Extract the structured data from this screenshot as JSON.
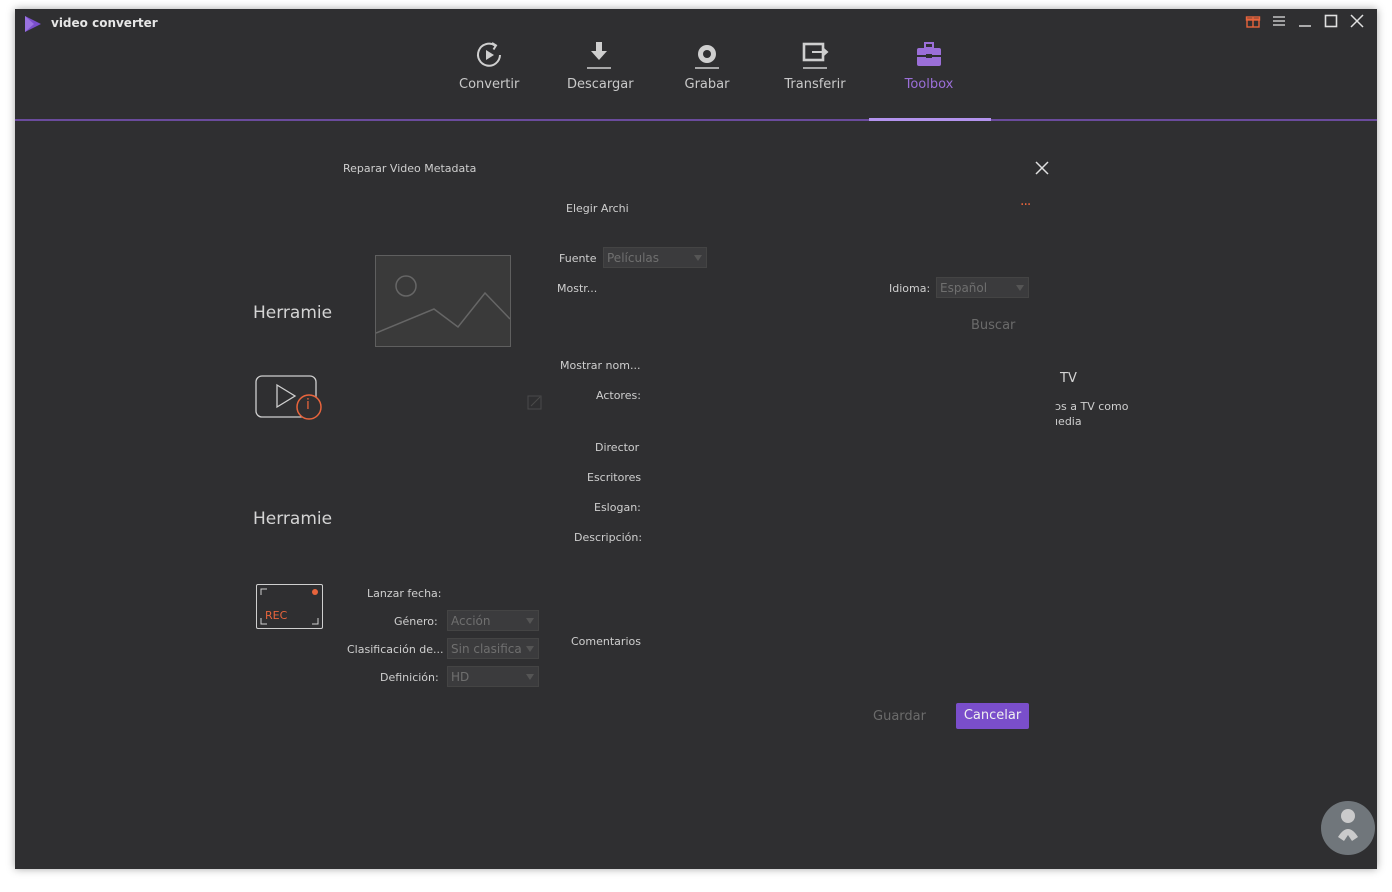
{
  "app": {
    "title": "video converter"
  },
  "nav": {
    "tabs": [
      {
        "label": "Convertir",
        "icon": "convert-icon"
      },
      {
        "label": "Descargar",
        "icon": "download-icon"
      },
      {
        "label": "Grabar",
        "icon": "record-icon"
      },
      {
        "label": "Transferir",
        "icon": "transfer-icon"
      },
      {
        "label": "Toolbox",
        "icon": "toolbox-icon"
      }
    ],
    "active_tab": "Toolbox"
  },
  "background": {
    "tool_title_1": "Herramie",
    "tool_title_2": "Herramie",
    "tv_title": "TV",
    "tv_desc_line1": "ɔs a TV como",
    "tv_desc_line2": "ıedia"
  },
  "dialog": {
    "title": "Reparar Video Metadata",
    "choose_file": "Elegir Archi",
    "more_symbol": "···",
    "source_label": "Fuente",
    "source_value": "Películas",
    "show_label": "Mostr...",
    "language_label": "Idioma:",
    "language_value": "Español",
    "search_label": "Buscar",
    "show_name_label": "Mostrar nom...",
    "actors_label": "Actores:",
    "director_label": "Director",
    "writers_label": "Escritores",
    "slogan_label": "Eslogan:",
    "description_label": "Descripción:",
    "release_label": "Lanzar fecha:",
    "genre_label": "Género:",
    "genre_value": "Acción",
    "rating_label": "Clasificación de...",
    "rating_value": "Sin clasifica",
    "definition_label": "Definición:",
    "definition_value": "HD",
    "comments_label": "Comentarios",
    "save_label": "Guardar",
    "cancel_label": "Cancelar",
    "rec_badge": "REC",
    "info_badge": "i"
  },
  "colors": {
    "accent": "#7a4ecb",
    "active_tab": "#9b6fd8",
    "window_bg": "#2f2f31",
    "record_orange": "#e8643c"
  }
}
